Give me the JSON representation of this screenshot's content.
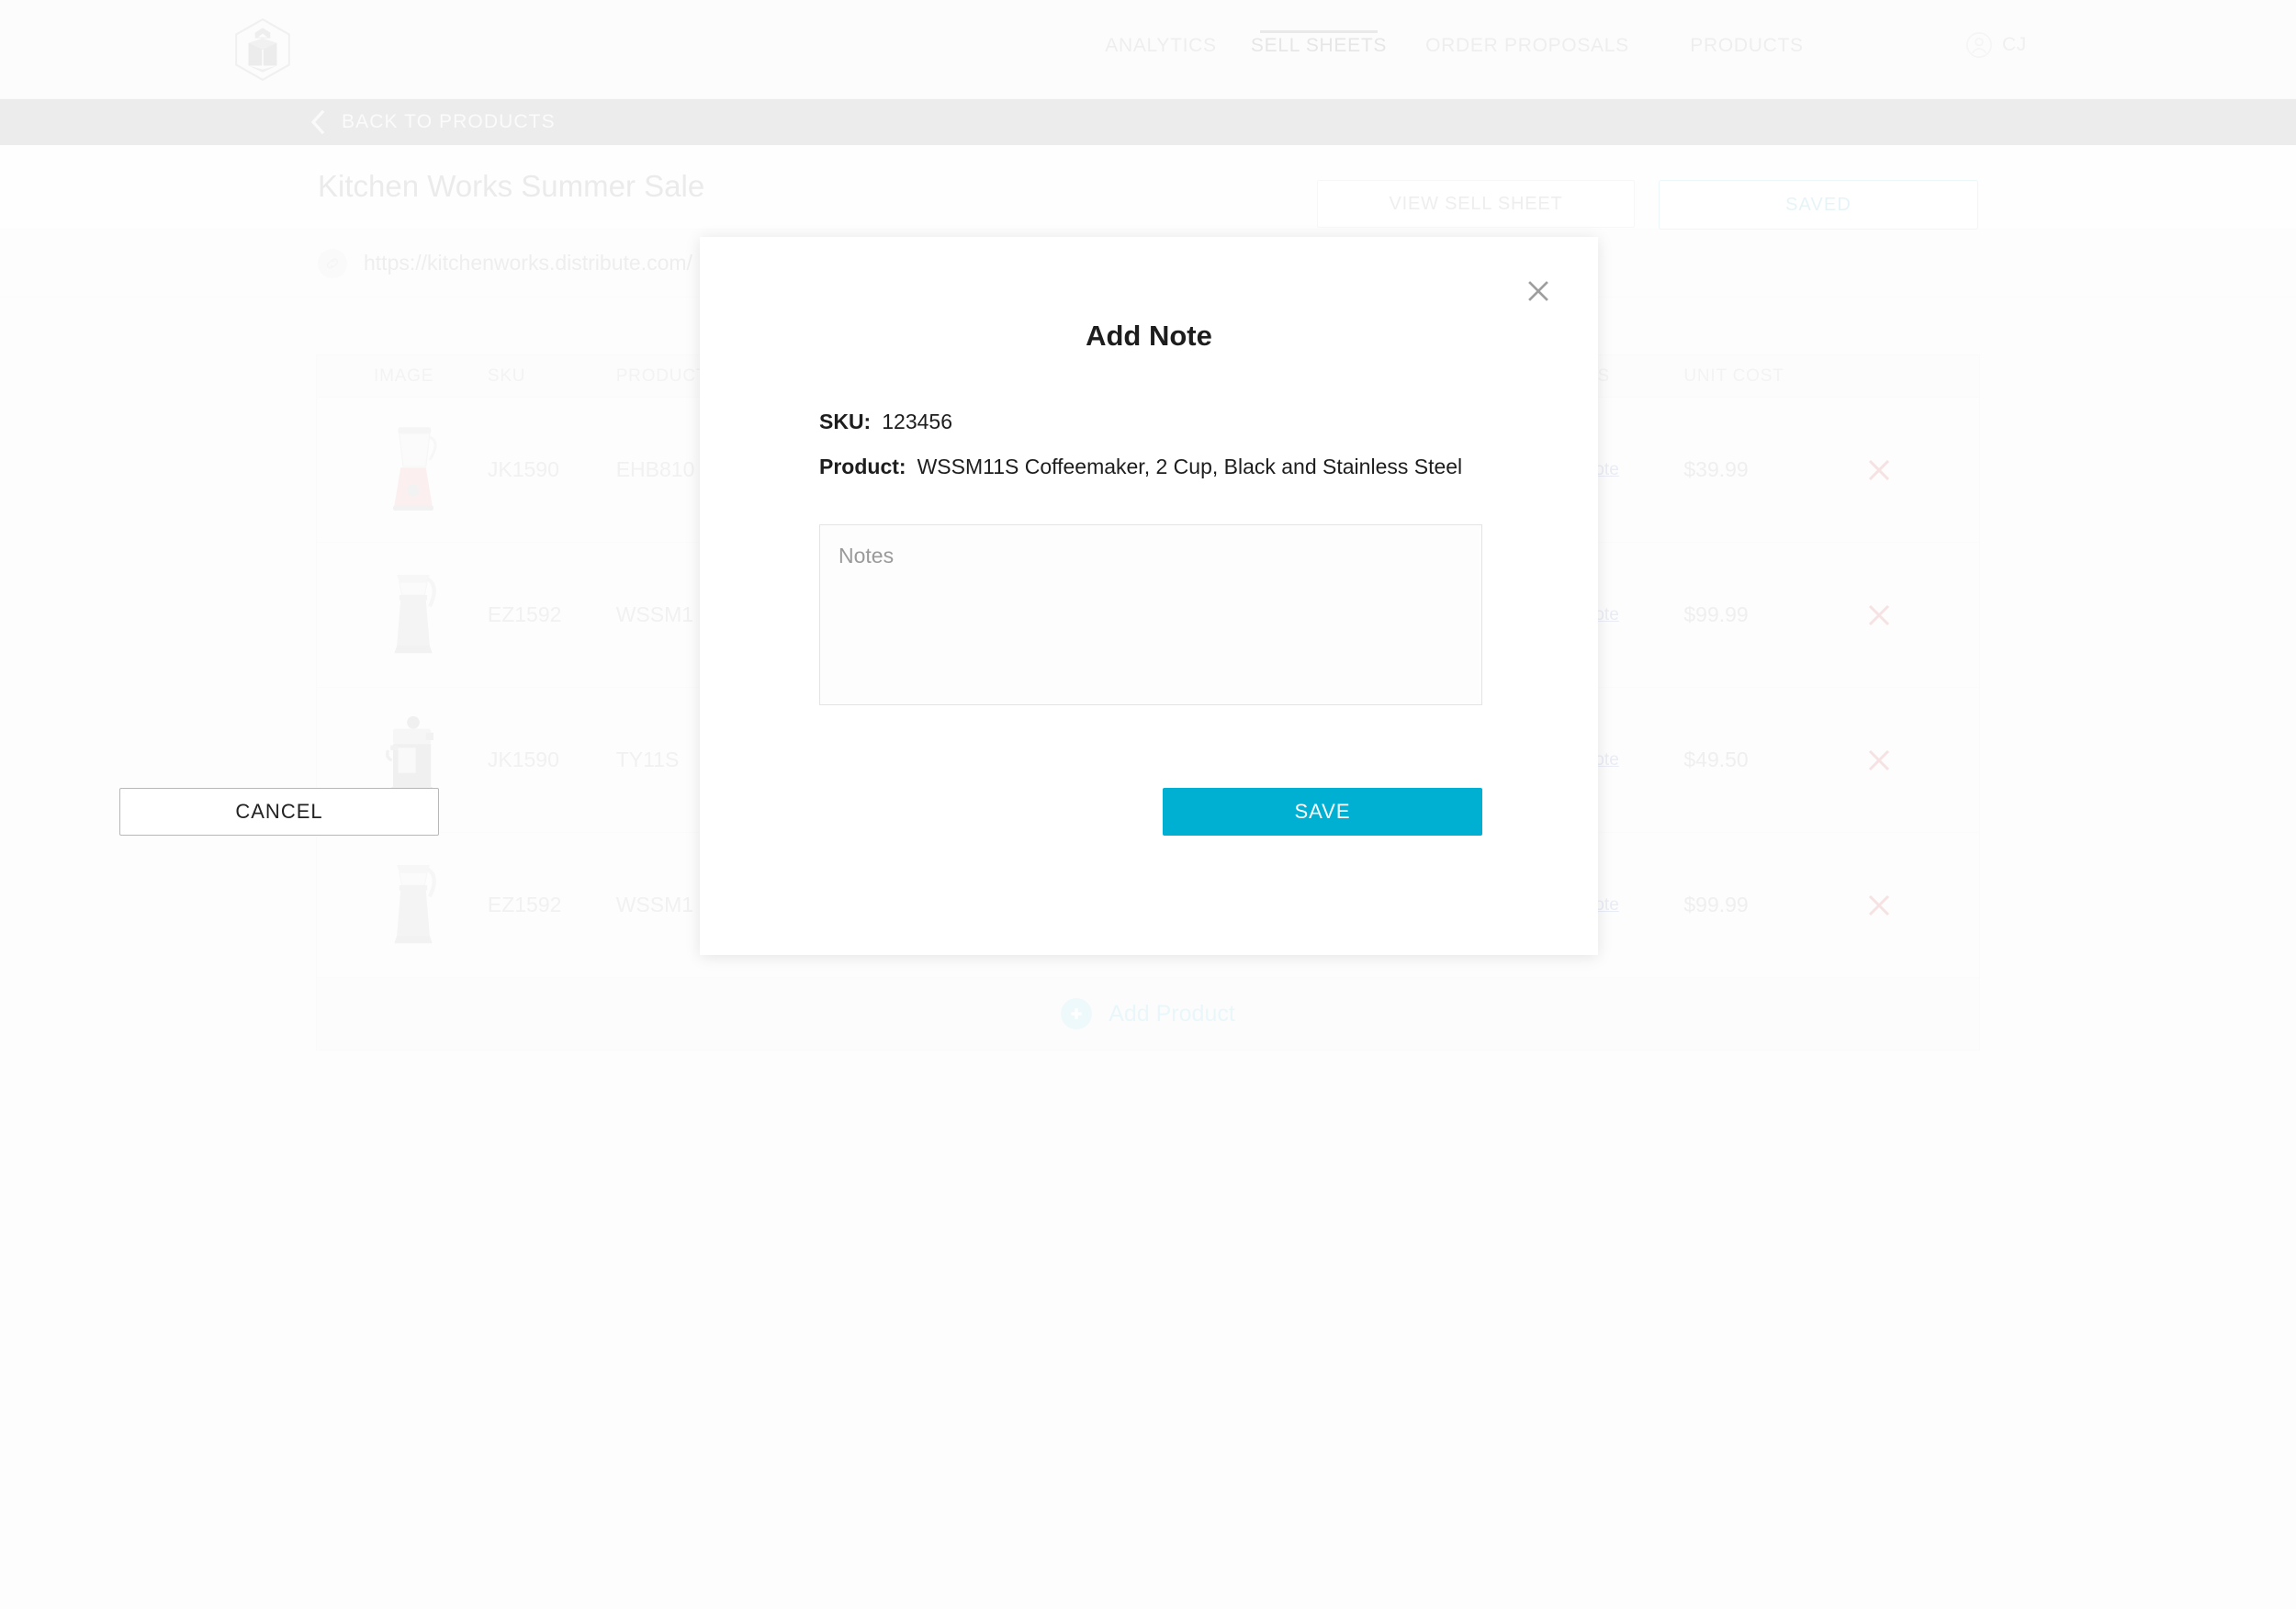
{
  "header": {
    "logo_icon": "hexagon-box-logo",
    "nav": [
      {
        "label": "ANALYTICS",
        "active": false
      },
      {
        "label": "SELL SHEETS",
        "active": true
      },
      {
        "label": "ORDER PROPOSALS",
        "active": false
      },
      {
        "label": "PRODUCTS",
        "active": false
      }
    ],
    "user": {
      "initials": "CJ",
      "icon": "user-circle-icon"
    }
  },
  "backbar": {
    "label": "BACK TO PRODUCTS",
    "icon": "chevron-left-icon"
  },
  "titlebar": {
    "title": "Kitchen Works Summer Sale",
    "view_sell_sheet_label": "VIEW SELL SHEET",
    "saved_label": "SAVED"
  },
  "urlbar": {
    "icon": "link-icon",
    "url": "https://kitchenworks.distribute.com/"
  },
  "table": {
    "columns": [
      "IMAGE",
      "SKU",
      "PRODUCT",
      "NOTES",
      "UNIT COST"
    ],
    "rows": [
      {
        "image": "blender-red-icon",
        "sku": "JK1590",
        "product": "EHB810",
        "note_link": "Add Note",
        "unit_cost": "$39.99",
        "delete_icon": "close-x-icon"
      },
      {
        "image": "coffeemaker-icon",
        "sku": "EZ1592",
        "product": "WSSM1",
        "note_link": "Add Note",
        "unit_cost": "$99.99",
        "delete_icon": "close-x-icon"
      },
      {
        "image": "espresso-machine-icon",
        "sku": "JK1590",
        "product": "TY11S",
        "note_link": "Add Note",
        "unit_cost": "$49.50",
        "delete_icon": "close-x-icon"
      },
      {
        "image": "coffeemaker-icon",
        "sku": "EZ1592",
        "product": "WSSM1",
        "note_link": "Add Note",
        "unit_cost": "$99.99",
        "delete_icon": "close-x-icon"
      }
    ],
    "add_product_label": "Add Product",
    "add_product_icon": "plus-circle-icon"
  },
  "modal": {
    "title": "Add Note",
    "close_icon": "close-x-icon",
    "sku_label": "SKU:",
    "sku_value": "123456",
    "product_label": "Product:",
    "product_value": "WSSM11S Coffeemaker, 2 Cup, Black and Stainless Steel",
    "notes_placeholder": "Notes",
    "notes_value": "",
    "cancel_label": "CANCEL",
    "save_label": "SAVE"
  },
  "colors": {
    "accent_cyan": "#00b0d3",
    "saved_border": "#a7d9e8",
    "add_product": "#9bd8e9",
    "delete_red": "#d4797f",
    "note_link": "#9aa7d6",
    "backbar_gray": "#a8a8a8"
  }
}
